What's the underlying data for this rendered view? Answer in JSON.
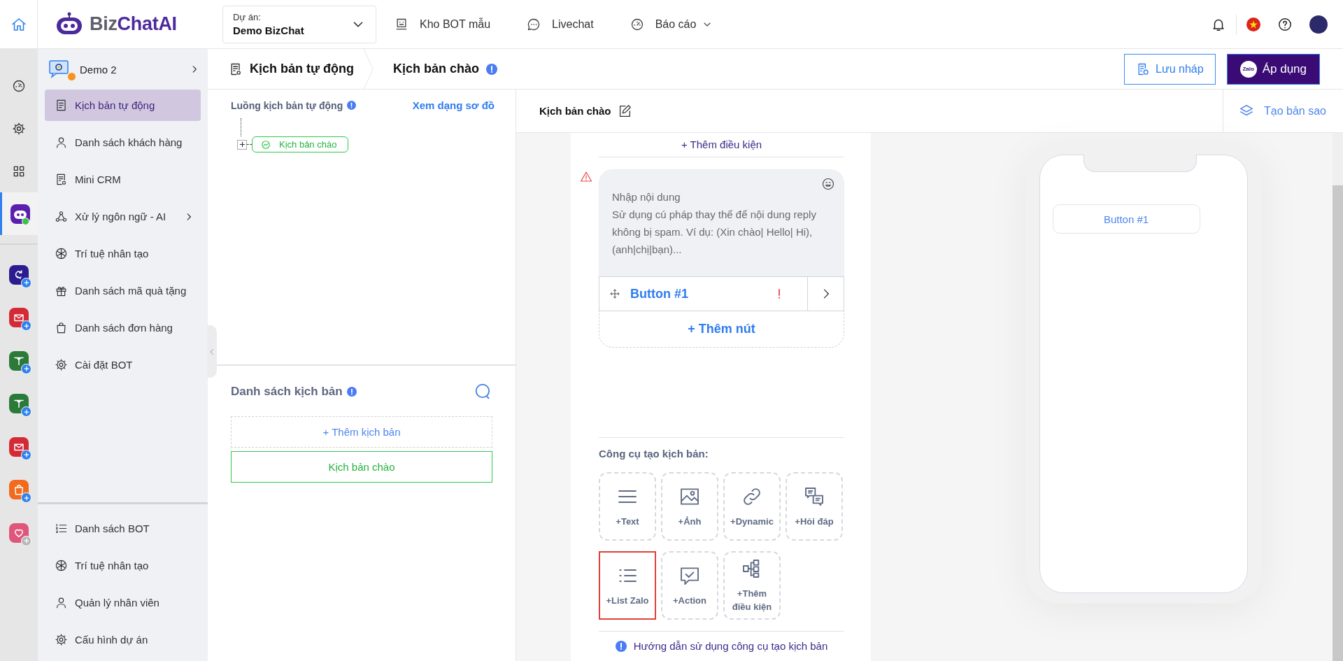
{
  "header": {
    "logo": {
      "prefix": "Biz",
      "name": "ChatAI"
    },
    "project": {
      "label": "Dự án:",
      "value": "Demo BizChat"
    },
    "nav": [
      {
        "label": "Kho BOT mẫu",
        "kind": "bot",
        "dropdown": false
      },
      {
        "label": "Livechat",
        "kind": "chat",
        "dropdown": false
      },
      {
        "label": "Báo cáo",
        "kind": "gauge",
        "dropdown": true
      }
    ]
  },
  "rail": {
    "tools": [
      {
        "kind": "dashboard",
        "selected": false,
        "online": false
      },
      {
        "kind": "settings",
        "selected": false,
        "online": false
      },
      {
        "kind": "grid",
        "selected": false,
        "online": false
      },
      {
        "kind": "bot",
        "selected": true,
        "online": true
      }
    ],
    "apps": [
      {
        "kind": "loop",
        "color": "#2b1d8f",
        "enabled": true
      },
      {
        "kind": "mail",
        "color": "#d42a36",
        "enabled": true
      },
      {
        "kind": "plane",
        "color": "#2c7a3a",
        "enabled": true
      },
      {
        "kind": "plane",
        "color": "#2c7a3a",
        "enabled": true
      },
      {
        "kind": "mail",
        "color": "#d42a36",
        "enabled": true
      },
      {
        "kind": "bag",
        "color": "#f26a1b",
        "enabled": true
      },
      {
        "kind": "heart",
        "color": "#e0557a",
        "enabled": false
      }
    ]
  },
  "sidebar": {
    "project": {
      "name": "Demo 2",
      "alert": true
    },
    "items": [
      {
        "label": "Kịch bản tự động",
        "kind": "doc",
        "selected": true,
        "submenu": false
      },
      {
        "label": "Danh sách khách hàng",
        "kind": "user",
        "selected": false,
        "submenu": false
      },
      {
        "label": "Mini CRM",
        "kind": "receipt",
        "selected": false,
        "submenu": false
      },
      {
        "label": "Xử lý ngôn ngữ - AI",
        "kind": "nodes",
        "selected": false,
        "submenu": true
      },
      {
        "label": "Trí tuệ nhân tạo",
        "kind": "flower",
        "selected": false,
        "submenu": false
      },
      {
        "label": "Danh sách mã quà tặng",
        "kind": "gift",
        "selected": false,
        "submenu": false
      },
      {
        "label": "Danh sách đơn hàng",
        "kind": "bag",
        "selected": false,
        "submenu": false
      },
      {
        "label": "Cài đặt BOT",
        "kind": "gear",
        "selected": false,
        "submenu": false
      }
    ],
    "bottom_items": [
      {
        "label": "Danh sách BOT",
        "kind": "numlist",
        "selected": false
      },
      {
        "label": "Trí tuệ nhân tạo",
        "kind": "flower",
        "selected": false
      },
      {
        "label": "Quản lý nhân viên",
        "kind": "user",
        "selected": false
      },
      {
        "label": "Cấu hình dự án",
        "kind": "gear",
        "selected": false
      }
    ]
  },
  "breadcrumb": {
    "parent": "Kịch bản tự động",
    "current": "Kịch bản chào"
  },
  "actions": {
    "draft": "Lưu nháp",
    "apply": "Áp dụng",
    "apply_badge": "Zalo"
  },
  "flow": {
    "title": "Luồng kịch bản tự động",
    "view_link": "Xem dạng sơ đồ",
    "node": "Kịch bản chào"
  },
  "scripts": {
    "title": "Danh sách kịch bản",
    "add": "+ Thêm kịch bản",
    "items": [
      {
        "label": "Kịch bản chào",
        "selected": true
      }
    ]
  },
  "editor": {
    "title": "Kịch bản chào",
    "duplicate": "Tạo bản sao",
    "add_condition": "+ Thêm điều kiện",
    "message": {
      "warning": true,
      "placeholder": "Nhập nội dung\nSử dụng cú pháp thay thế để nội dung reply không bị spam. Ví dụ: (Xin chào| Hello| Hi), (anh|chị|bạn)...",
      "buttons": [
        {
          "label": "Button #1",
          "error": true
        }
      ],
      "add_button": "+ Thêm nút"
    },
    "tools_title": "Công cụ tạo kịch bản:",
    "tools": [
      {
        "label": "+Text",
        "kind": "text",
        "selected": false
      },
      {
        "label": "+Ảnh",
        "kind": "image",
        "selected": false
      },
      {
        "label": "+Dynamic",
        "kind": "link",
        "selected": false
      },
      {
        "label": "+Hỏi đáp",
        "kind": "qa",
        "selected": false
      },
      {
        "label": "+List Zalo",
        "kind": "list",
        "selected": true
      },
      {
        "label": "+Action",
        "kind": "action",
        "selected": false
      },
      {
        "label": "+Thêm điều kiện",
        "kind": "flow",
        "selected": false
      }
    ],
    "guide": "Hướng dẫn sử dụng công cụ tạo kịch bản"
  },
  "preview": {
    "buttons": [
      "Button #1"
    ]
  }
}
